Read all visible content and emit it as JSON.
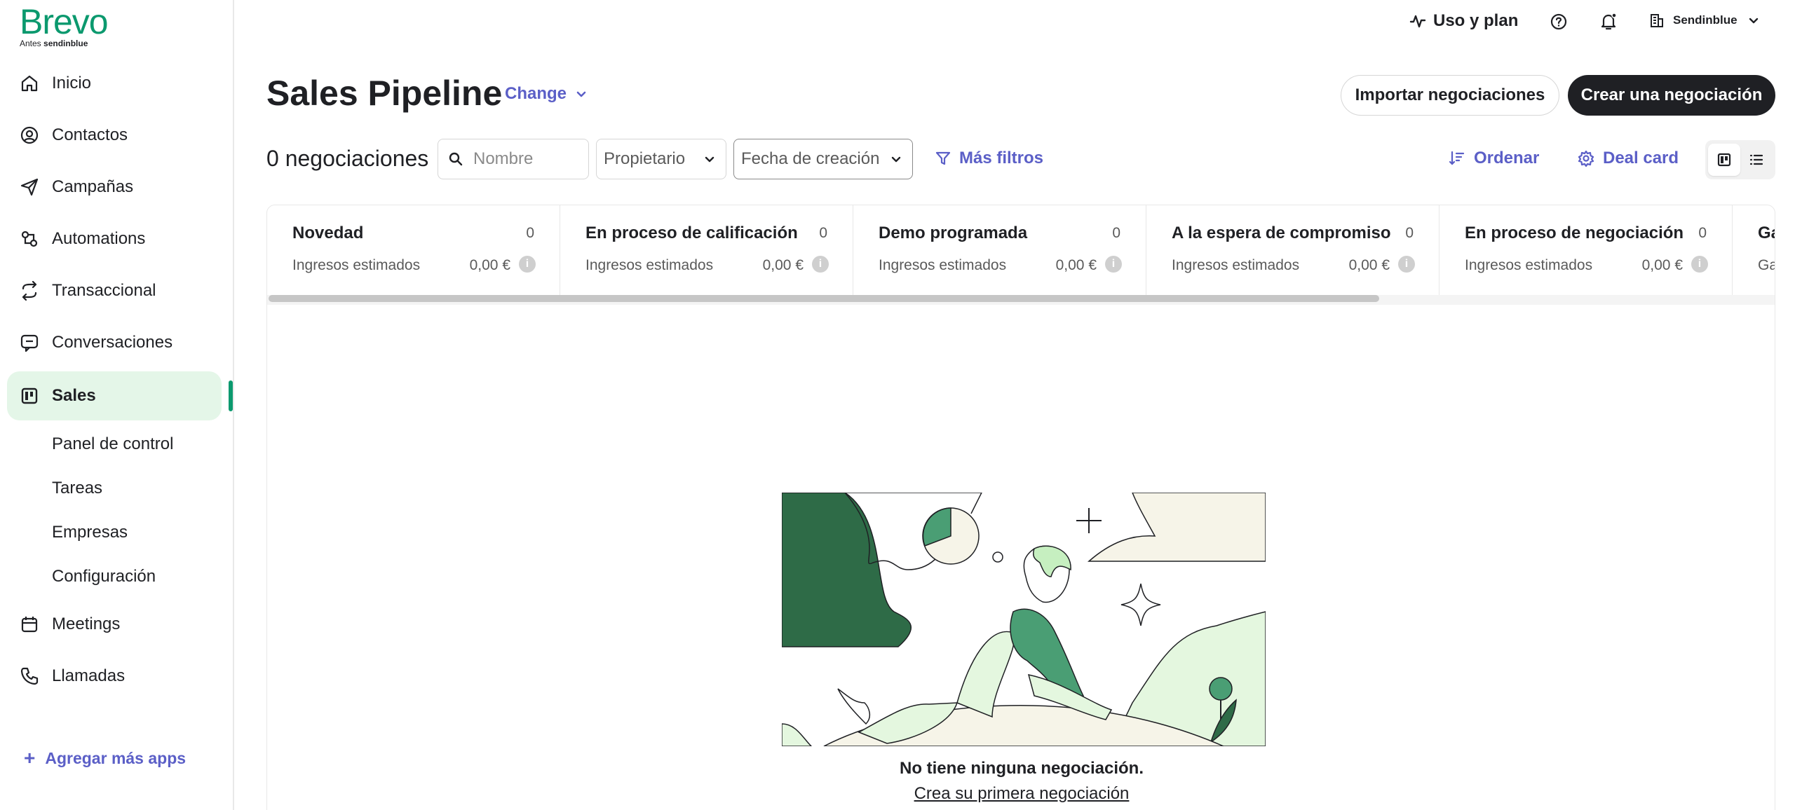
{
  "brand": {
    "logo": "Brevo",
    "sub_prefix": "Antes",
    "sub_name": "sendinblue"
  },
  "sidebar": {
    "items": [
      {
        "label": "Inicio",
        "icon": "home-icon"
      },
      {
        "label": "Contactos",
        "icon": "contacts-icon"
      },
      {
        "label": "Campañas",
        "icon": "send-icon"
      },
      {
        "label": "Automations",
        "icon": "automations-icon"
      },
      {
        "label": "Transaccional",
        "icon": "transactional-icon"
      },
      {
        "label": "Conversaciones",
        "icon": "chat-icon"
      },
      {
        "label": "Sales",
        "icon": "sales-icon",
        "active": true
      },
      {
        "label": "Meetings",
        "icon": "calendar-icon"
      },
      {
        "label": "Llamadas",
        "icon": "phone-icon"
      }
    ],
    "sub_items": [
      "Panel de control",
      "Tareas",
      "Empresas",
      "Configuración"
    ],
    "add_apps": "Agregar más apps"
  },
  "topbar": {
    "usage": "Uso y plan",
    "account": "Sendinblue"
  },
  "header": {
    "title": "Sales Pipeline",
    "change": "Change",
    "import_button": "Importar negociaciones",
    "create_button": "Crear una negociación"
  },
  "filters": {
    "deal_count": "0 negociaciones",
    "search_placeholder": "Nombre",
    "owner": "Propietario",
    "date": "Fecha de creación",
    "more_filters": "Más filtros",
    "order": "Ordenar",
    "deal_card": "Deal card"
  },
  "stages": [
    {
      "name": "Novedad",
      "count": "0",
      "revenue_label": "Ingresos estimados",
      "amount": "0,00 €"
    },
    {
      "name": "En proceso de calificación",
      "count": "0",
      "revenue_label": "Ingresos estimados",
      "amount": "0,00 €"
    },
    {
      "name": "Demo programada",
      "count": "0",
      "revenue_label": "Ingresos estimados",
      "amount": "0,00 €"
    },
    {
      "name": "A la espera de compromiso",
      "count": "0",
      "revenue_label": "Ingresos estimados",
      "amount": "0,00 €"
    },
    {
      "name": "En proceso de negociación",
      "count": "0",
      "revenue_label": "Ingresos estimados",
      "amount": "0,00 €"
    },
    {
      "name": "Ga",
      "count": "",
      "revenue_label": "Ga",
      "amount": ""
    }
  ],
  "empty_state": {
    "title": "No tiene ninguna negociación.",
    "link": "Crea su primera negociación"
  },
  "colors": {
    "brand_green": "#0b996e",
    "accent_purple": "#5b5fc7",
    "active_bg": "#e4f6e8",
    "dark_button": "#1f2024"
  }
}
